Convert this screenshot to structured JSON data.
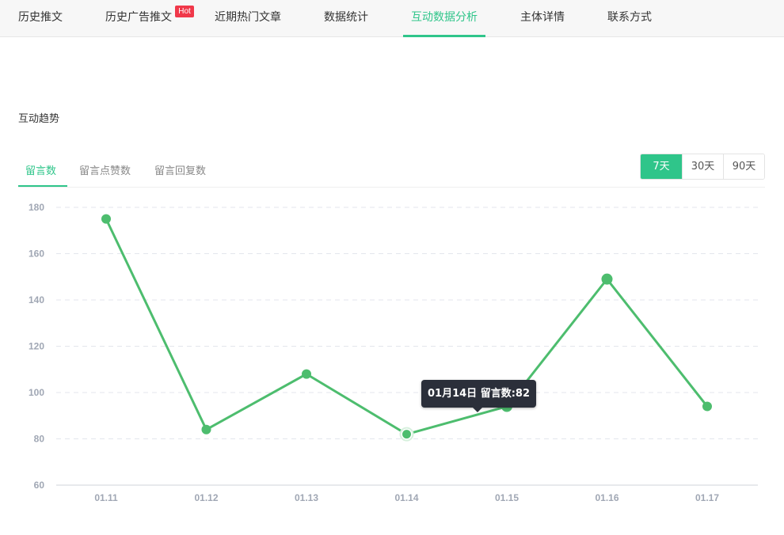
{
  "nav": {
    "tabs": [
      {
        "label": "历史推文"
      },
      {
        "label": "历史广告推文"
      },
      {
        "label": "近期热门文章"
      },
      {
        "label": "数据统计"
      },
      {
        "label": "互动数据分析"
      },
      {
        "label": "主体详情"
      },
      {
        "label": "联系方式"
      }
    ],
    "active_index": 4,
    "hot_badge": "Hot"
  },
  "section": {
    "title": "互动趋势"
  },
  "metric_tabs": [
    {
      "label": "留言数"
    },
    {
      "label": "留言点赞数"
    },
    {
      "label": "留言回复数"
    }
  ],
  "range_buttons": [
    {
      "label": "7天"
    },
    {
      "label": "30天"
    },
    {
      "label": "90天"
    }
  ],
  "active_range_index": 0,
  "tooltip": {
    "text": "01月14日 留言数:82"
  },
  "colors": {
    "accent": "#2fc58a",
    "line": "#4dbd6e",
    "tooltip_bg": "#2b2f3a",
    "hot": "#f0384a"
  },
  "chart_data": {
    "type": "line",
    "categories": [
      "01.11",
      "01.12",
      "01.13",
      "01.14",
      "01.15",
      "01.16",
      "01.17"
    ],
    "series": [
      {
        "name": "留言数",
        "values": [
          175,
          84,
          108,
          82,
          94,
          149,
          94
        ]
      }
    ],
    "ylim": [
      60,
      180
    ],
    "yticks": [
      60,
      80,
      100,
      120,
      140,
      160,
      180
    ],
    "grid": true,
    "highlight_index": 3
  }
}
